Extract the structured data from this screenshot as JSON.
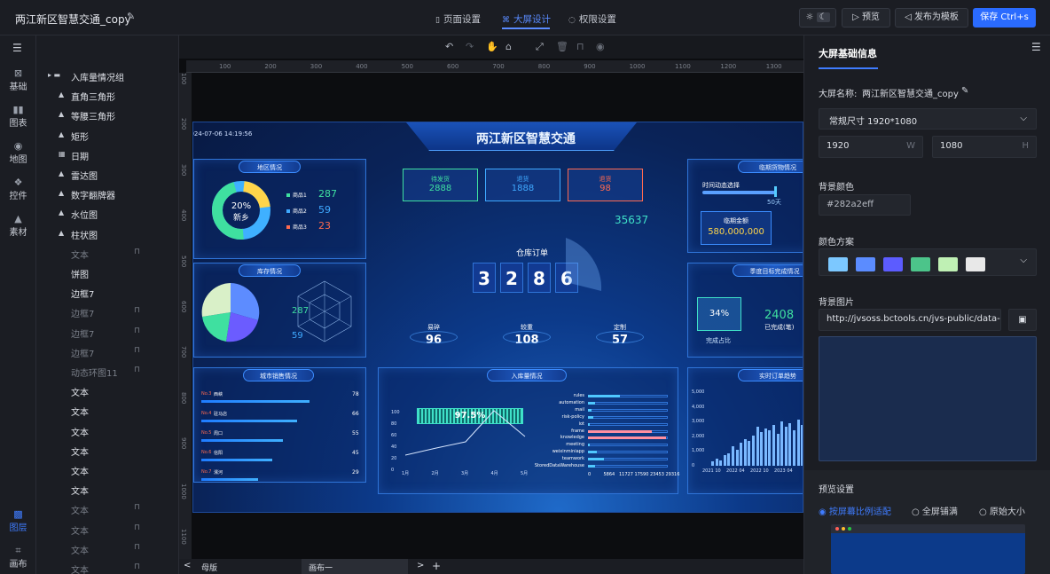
{
  "app": {
    "title": "两江新区智慧交通_copy",
    "tabs": [
      {
        "label": "页面设置",
        "icon": "▯"
      },
      {
        "label": "大屏设计",
        "icon": "⌘"
      },
      {
        "label": "权限设置",
        "icon": "◌"
      }
    ],
    "buttons": {
      "preview": "预览",
      "publish": "发布为模板",
      "save": "保存 Ctrl+s"
    }
  },
  "nav": {
    "items": [
      "基础",
      "图表",
      "地图",
      "控件",
      "素材"
    ],
    "bottom": [
      "图层",
      "画布"
    ]
  },
  "layers": [
    {
      "label": "入库量情况组",
      "icon": "▸ ▬",
      "off": false,
      "lock": false
    },
    {
      "label": "直角三角形",
      "icon": "▲",
      "off": false,
      "lock": false
    },
    {
      "label": "等腰三角形",
      "icon": "▲",
      "off": false,
      "lock": false
    },
    {
      "label": "矩形",
      "icon": "▲",
      "off": false,
      "lock": false
    },
    {
      "label": "日期",
      "icon": "▦",
      "off": false,
      "lock": false
    },
    {
      "label": "雷达图",
      "icon": "▲",
      "off": false,
      "lock": false
    },
    {
      "label": "数字翻牌器",
      "icon": "▲",
      "off": false,
      "lock": false
    },
    {
      "label": "水位图",
      "icon": "▲",
      "off": false,
      "lock": false
    },
    {
      "label": "柱状图",
      "icon": "▲",
      "off": false,
      "lock": false
    },
    {
      "label": "文本",
      "icon": "",
      "off": true,
      "lock": true
    },
    {
      "label": "饼图",
      "icon": "",
      "off": false,
      "lock": false
    },
    {
      "label": "边框7",
      "icon": "",
      "off": false,
      "lock": false
    },
    {
      "label": "边框7",
      "icon": "",
      "off": true,
      "lock": true
    },
    {
      "label": "边框7",
      "icon": "",
      "off": true,
      "lock": true
    },
    {
      "label": "边框7",
      "icon": "",
      "off": true,
      "lock": true
    },
    {
      "label": "动态环图11",
      "icon": "",
      "off": true,
      "lock": true
    },
    {
      "label": "文本",
      "icon": "",
      "off": false,
      "lock": false
    },
    {
      "label": "文本",
      "icon": "",
      "off": false,
      "lock": false
    },
    {
      "label": "文本",
      "icon": "",
      "off": false,
      "lock": false
    },
    {
      "label": "文本",
      "icon": "",
      "off": false,
      "lock": false
    },
    {
      "label": "文本",
      "icon": "",
      "off": false,
      "lock": false
    },
    {
      "label": "文本",
      "icon": "",
      "off": false,
      "lock": false
    },
    {
      "label": "文本",
      "icon": "",
      "off": true,
      "lock": true
    },
    {
      "label": "文本",
      "icon": "",
      "off": true,
      "lock": true
    },
    {
      "label": "文本",
      "icon": "",
      "off": true,
      "lock": true
    },
    {
      "label": "文本",
      "icon": "",
      "off": true,
      "lock": true
    }
  ],
  "ruler": {
    "h": [
      "100",
      "200",
      "300",
      "400",
      "500",
      "600",
      "700",
      "800",
      "900",
      "1000",
      "1100",
      "1200",
      "1300",
      "1400",
      "1500",
      "1600",
      "1700",
      "1800"
    ],
    "v": [
      "100",
      "200",
      "300",
      "400",
      "500",
      "600",
      "700",
      "800",
      "900",
      "1000",
      "1100",
      "1200"
    ]
  },
  "bottom": {
    "tab1": "母版",
    "tab2": "画布一"
  },
  "screen": {
    "title": "两江新区智慧交通",
    "datetime": "2024-07-06 14:19:56",
    "p1": {
      "title": "地区情况",
      "pct": "20%",
      "city": "新乡",
      "legend": [
        {
          "n": "商品1",
          "v": "287",
          "c": "#3fe0a0"
        },
        {
          "n": "商品2",
          "v": "59",
          "c": "#3fa9ff"
        },
        {
          "n": "商品3",
          "v": "23",
          "c": "#ff6a4f"
        }
      ]
    },
    "p2": {
      "title": "库存情况",
      "nums": [
        "287",
        "59"
      ]
    },
    "p3": {
      "title": "城市销售情况",
      "rows": [
        {
          "n": "No.3",
          "c": "西峡",
          "v": "78"
        },
        {
          "n": "No.4",
          "c": "驻马店",
          "v": "66"
        },
        {
          "n": "No.5",
          "c": "周口",
          "v": "55"
        },
        {
          "n": "No.6",
          "c": "信阳",
          "v": "45"
        },
        {
          "n": "No.7",
          "c": "漯河",
          "v": "29"
        }
      ]
    },
    "center": {
      "cards": [
        {
          "l": "待发货",
          "v": "2888",
          "c": "#3fe0a0"
        },
        {
          "l": "退货",
          "v": "1888",
          "c": "#3fa9ff"
        },
        {
          "l": "退货",
          "v": "98",
          "c": "#ff6a4f"
        }
      ],
      "big": "35637",
      "order_label": "仓库订单",
      "digits": [
        "3",
        "2",
        "8",
        "6"
      ],
      "stats": [
        {
          "l": "易碎",
          "v": "96"
        },
        {
          "l": "较重",
          "v": "108"
        },
        {
          "l": "定制",
          "v": "57"
        }
      ]
    },
    "p4": {
      "title": "入库量情况",
      "pct": "97.5%",
      "line_x": [
        "1月",
        "2月",
        "3月",
        "4月",
        "5月"
      ],
      "line_y": [
        "0",
        "20",
        "40",
        "60",
        "80",
        "100"
      ],
      "bars": [
        "rules",
        "automation",
        "mail",
        "risk-policy",
        "iot",
        "frame",
        "knowledge",
        "meeting",
        "weixinminiapp",
        "teamwork",
        "StoredDataWarehouse"
      ],
      "bar_x": [
        "0",
        "5864",
        "11727",
        "17590",
        "23453",
        "29316"
      ]
    },
    "p5": {
      "title": "临期货物情况",
      "slider_label": "时间动态选择",
      "slider_val": "50天",
      "amount_label": "临期金额",
      "amount": "580,000,000"
    },
    "p6": {
      "title": "季度目标完成情况",
      "pct": "34%",
      "done_label": "完成占比",
      "done_val": "2408",
      "done_unit": "已完成(笔)"
    },
    "p7": {
      "title": "实时订单趋势",
      "y": [
        "5,000",
        "4,000",
        "3,000",
        "2,000",
        "1,000",
        "0"
      ],
      "x": [
        "2021 10",
        "2022 04",
        "2022 10",
        "2023 04"
      ]
    }
  },
  "rpanel": {
    "tab": "大屏基础信息",
    "name_label": "大屏名称:",
    "name": "两江新区智慧交通_copy",
    "size": "常规尺寸 1920*1080",
    "w": "1920",
    "w_unit": "W",
    "h": "1080",
    "h_unit": "H",
    "bg_label": "背景颜色",
    "bg": "#282a2eff",
    "scheme_label": "颜色方案",
    "scheme": [
      "#7cc8ff",
      "#5b8cff",
      "#5c5cff",
      "#4cc48a",
      "#bff0b4",
      "#e8e8e8"
    ],
    "img_label": "背景图片",
    "img_url": "http://jvsoss.bctools.cn/jvs-public/data-sc",
    "preview_label": "预览设置",
    "radios": [
      "按屏幕比例适配",
      "全屏铺满",
      "原始大小"
    ]
  }
}
